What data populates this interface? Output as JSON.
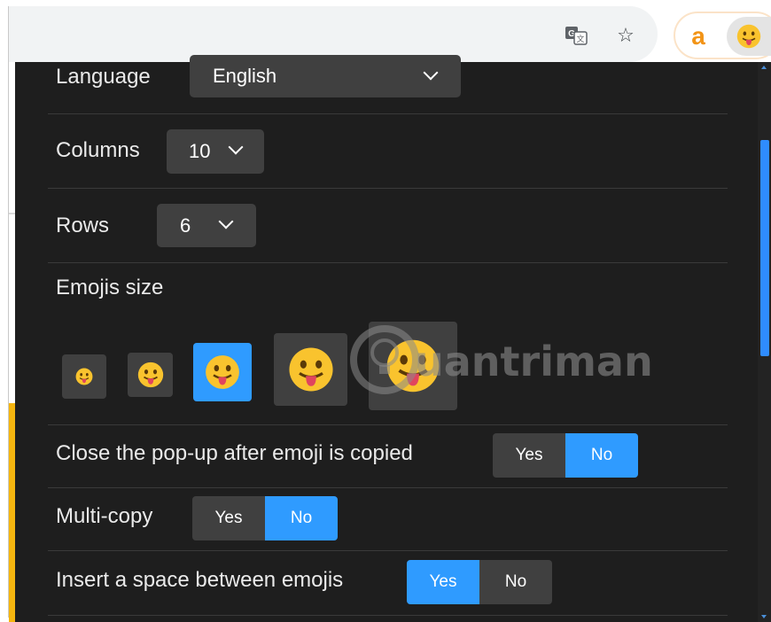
{
  "toolbar": {
    "icons": [
      "translate-icon",
      "star-icon",
      "extension-a-icon",
      "emoji-extension-icon"
    ],
    "star_glyph": "☆",
    "ext_a_glyph": "a"
  },
  "settings": {
    "language": {
      "label": "Language",
      "value": "English"
    },
    "columns": {
      "label": "Columns",
      "value": "10"
    },
    "rows": {
      "label": "Rows",
      "value": "6"
    },
    "emoji_size": {
      "label": "Emojis size",
      "options": [
        "xs",
        "s",
        "m",
        "l",
        "xl"
      ],
      "selected_index": 2
    },
    "close_popup": {
      "label": "Close the pop-up after emoji is copied",
      "yes": "Yes",
      "no": "No",
      "selected": "No"
    },
    "multi_copy": {
      "label": "Multi-copy",
      "yes": "Yes",
      "no": "No",
      "selected": "No"
    },
    "insert_space": {
      "label": "Insert a space between emojis",
      "yes": "Yes",
      "no": "No",
      "selected": "Yes"
    }
  },
  "watermark": {
    "text": "uantrimang"
  },
  "colors": {
    "panel_bg": "#1e1e1e",
    "control_bg": "#404040",
    "accent": "#2f9bff",
    "emoji_yellow": "#f9c32e",
    "extension_orange": "#f29417",
    "side_strip": "#f5b50f"
  }
}
